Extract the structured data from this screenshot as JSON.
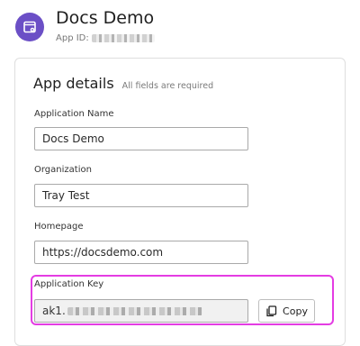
{
  "app": {
    "title": "Docs Demo",
    "id_label": "App ID:",
    "icon": "app-settings-icon",
    "icon_color": "#6b4fc6"
  },
  "section": {
    "title": "App details",
    "note": "All fields are required"
  },
  "fields": {
    "application_name": {
      "label": "Application Name",
      "value": "Docs Demo"
    },
    "organization": {
      "label": "Organization",
      "value": "Tray Test"
    },
    "homepage": {
      "label": "Homepage",
      "value": "https://docsdemo.com"
    },
    "application_key": {
      "label": "Application Key",
      "value_prefix": "ak1.",
      "highlight_color": "#e43ce3"
    }
  },
  "copy_button": {
    "label": "Copy",
    "icon": "copy-icon"
  }
}
